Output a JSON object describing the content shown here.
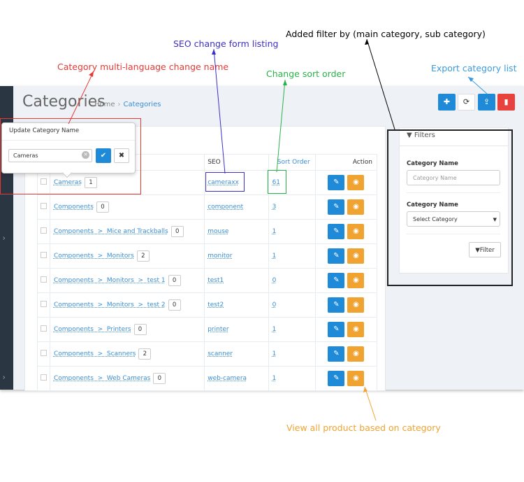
{
  "annotations": {
    "filter": "Added filter by (main category, sub category)",
    "seo": "SEO change form listing",
    "multilang": "Category multi-language change name",
    "sort": "Change sort order",
    "export": "Export category list",
    "view": "View all product based on category"
  },
  "colors": {
    "annotation_black": "#000000",
    "annotation_purple": "#3b2fc9",
    "annotation_red": "#e53935",
    "annotation_green": "#2ab24a",
    "annotation_blue": "#3a9be0",
    "annotation_orange": "#f0a331",
    "sidebar_bg": "#2b3643",
    "primary_blue": "#1f8bd8",
    "danger_red": "#e8423f"
  },
  "page": {
    "title": "Categories",
    "breadcrumb": [
      "Home",
      "Categories"
    ]
  },
  "toolbar": {
    "add_icon": "plus-icon",
    "refresh_icon": "refresh-icon",
    "export_icon": "upload-icon",
    "delete_icon": "trash-icon"
  },
  "popup": {
    "title": "Update Category Name",
    "value": "Cameras",
    "clear_icon": "clear-icon",
    "save_icon": "check-icon",
    "cancel_icon": "close-icon"
  },
  "table": {
    "headers": {
      "seo": "SEO",
      "sort": "Sort Order",
      "action": "Action"
    },
    "rows": [
      {
        "name": "Cameras",
        "count": "1",
        "seo": "cameraxx",
        "sort": "61"
      },
      {
        "name": "Components",
        "count": "0",
        "seo": "component",
        "sort": "3"
      },
      {
        "name": "Components  >  Mice and Trackballs",
        "count": "0",
        "seo": "mouse",
        "sort": "1"
      },
      {
        "name": "Components  >  Monitors",
        "count": "2",
        "seo": "monitor",
        "sort": "1"
      },
      {
        "name": "Components  >  Monitors  >  test 1",
        "count": "0",
        "seo": "test1",
        "sort": "0"
      },
      {
        "name": "Components  >  Monitors  >  test 2",
        "count": "0",
        "seo": "test2",
        "sort": "0"
      },
      {
        "name": "Components  >  Printers",
        "count": "0",
        "seo": "printer",
        "sort": "1"
      },
      {
        "name": "Components  >  Scanners",
        "count": "2",
        "seo": "scanner",
        "sort": "1"
      },
      {
        "name": "Components  >  Web Cameras",
        "count": "0",
        "seo": "web-camera",
        "sort": "1"
      }
    ]
  },
  "filters": {
    "title": "Filters",
    "label1": "Category Name",
    "input_placeholder": "Category Name",
    "label2": "Category Name",
    "select_value": "Select Category",
    "button": "Filter"
  }
}
